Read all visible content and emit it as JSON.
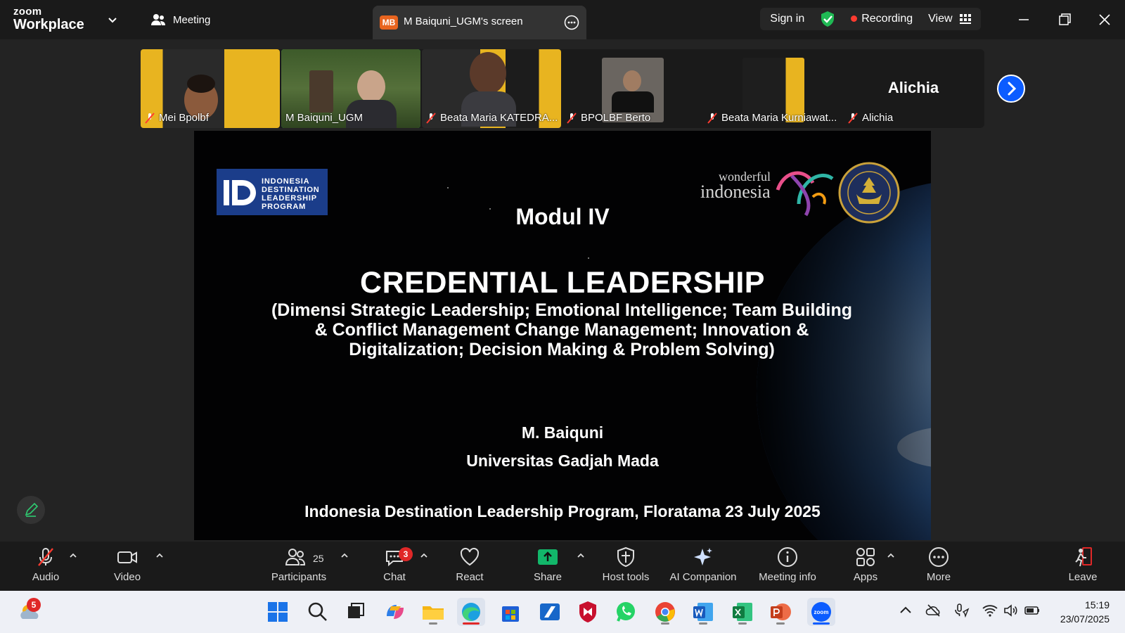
{
  "titlebar": {
    "logo_top": "zoom",
    "logo_bottom": "Workplace",
    "meeting_label": "Meeting",
    "tab_badge": "MB",
    "tab_title": "M Baiquni_UGM's screen",
    "sign_in": "Sign in",
    "recording": "Recording",
    "view": "View"
  },
  "gallery": {
    "tiles": [
      {
        "name": "Mei Bpolbf",
        "muted": true
      },
      {
        "name": "M Baiquni_UGM",
        "muted": false,
        "active": true
      },
      {
        "name": "Beata Maria KATEDRA...",
        "muted": true
      },
      {
        "name": "BPOLBF Berto",
        "muted": true
      },
      {
        "name": "Beata Maria Kurniawat...",
        "muted": true
      },
      {
        "name": "Alichia",
        "muted": true
      }
    ],
    "alichia_display": "Alichia"
  },
  "slide": {
    "logo_lines": [
      "INDONESIA",
      "DESTINATION",
      "LEADERSHIP",
      "PROGRAM"
    ],
    "wonderful_1": "wonderful",
    "wonderful_2": "indonesia",
    "modul": "Modul IV",
    "title": "CREDENTIAL LEADERSHIP",
    "dimensions": "(Dimensi Strategic Leadership; Emotional Intelligence; Team Building & Conflict Management Change Management; Innovation & Digitalization; Decision Making & Problem Solving)",
    "author": "M. Baiquni",
    "university": "Universitas Gadjah Mada",
    "program": "Indonesia Destination Leadership Program, Floratama 23 July 2025"
  },
  "toolbar": {
    "audio": "Audio",
    "video": "Video",
    "participants": "Participants",
    "participants_count": "25",
    "chat": "Chat",
    "chat_badge": "3",
    "react": "React",
    "share": "Share",
    "host_tools": "Host tools",
    "ai_companion": "AI Companion",
    "meeting_info": "Meeting info",
    "apps": "Apps",
    "more": "More",
    "leave": "Leave"
  },
  "taskbar": {
    "weather_badge": "5",
    "time": "15:19",
    "date": "23/07/2025"
  },
  "colors": {
    "zoom_blue": "#0b5cff",
    "recording_red": "#ff3b30",
    "active_green": "#2ecc71",
    "share_green": "#12b76a"
  }
}
